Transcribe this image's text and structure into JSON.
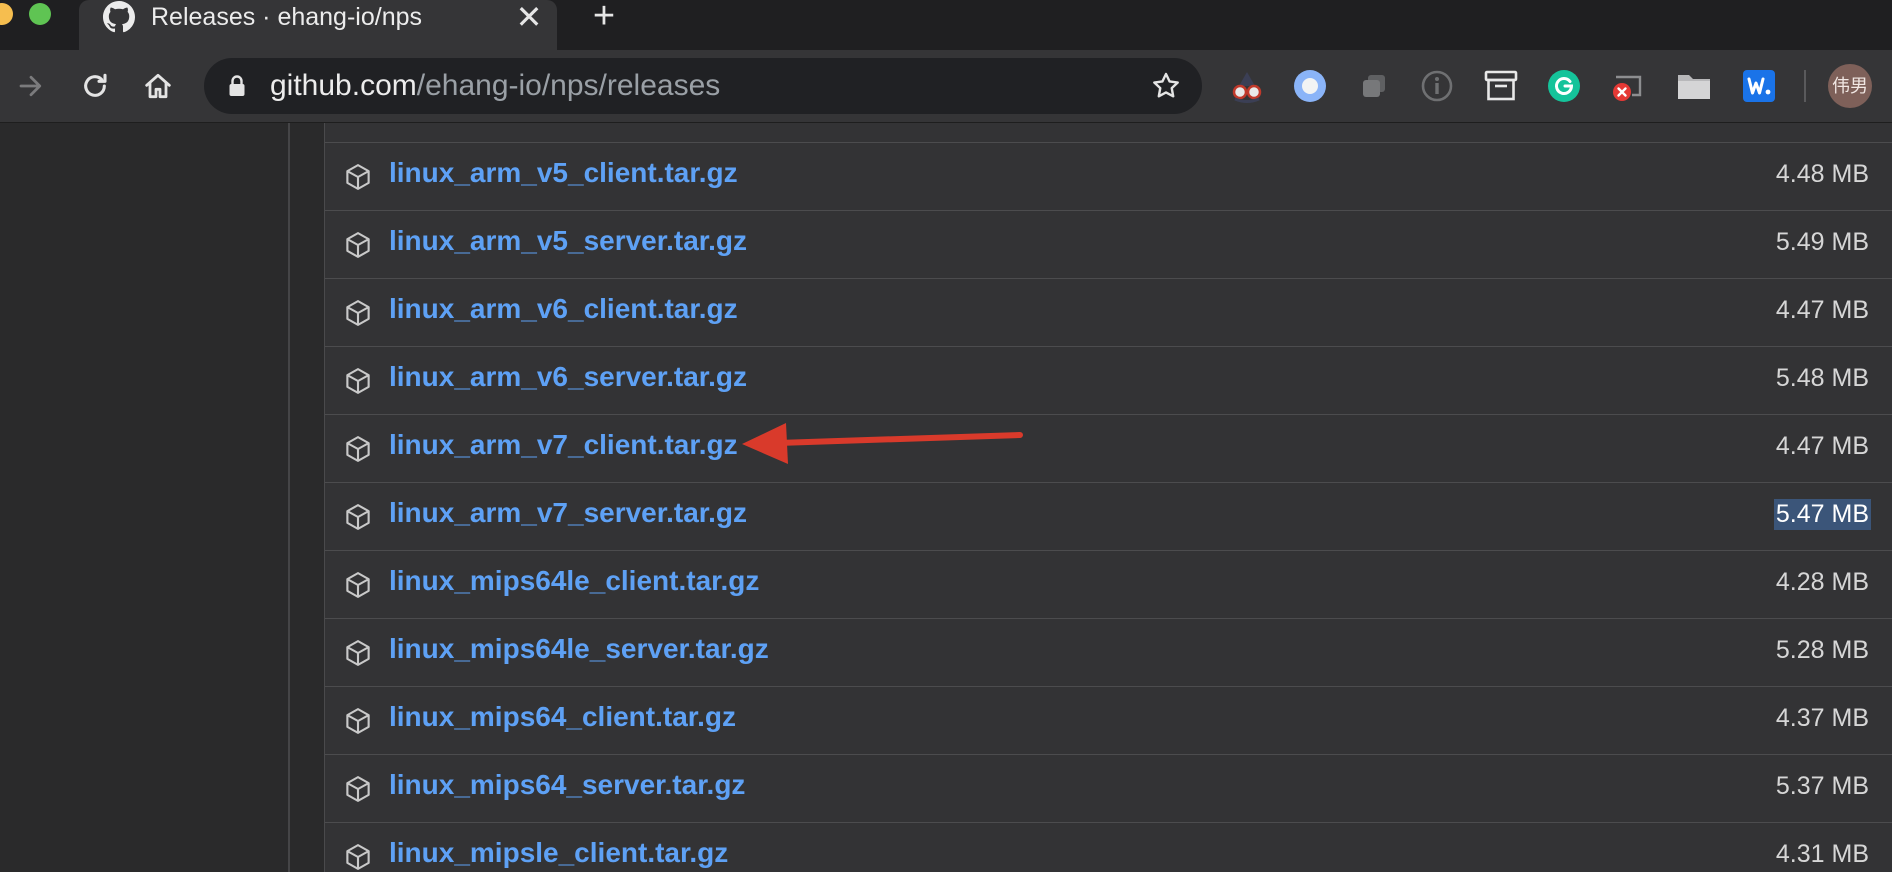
{
  "browser": {
    "tab_title": "Releases · ehang-io/nps",
    "close_glyph": "✕",
    "new_tab_glyph": "+",
    "url_host": "github.com",
    "url_path": "/ehang-io/nps/releases"
  },
  "extensions": [
    {
      "icon": "spy-glasses-icon"
    },
    {
      "icon": "circle-ring-icon",
      "color": "#8ab4f8"
    },
    {
      "icon": "copy-squares-icon"
    },
    {
      "icon": "info-circle-icon"
    },
    {
      "icon": "archive-box-icon"
    },
    {
      "icon": "grammarly-icon",
      "color": "#15c39a"
    },
    {
      "icon": "cast-blocked-icon",
      "color": "#e53935"
    },
    {
      "icon": "folder-icon"
    },
    {
      "icon": "word-w-icon",
      "color": "#1a73e8"
    }
  ],
  "profile": {
    "avatar_text": "伟男"
  },
  "assets": [
    {
      "name": "linux_arm_v5_client.tar.gz",
      "size": "4.48 MB"
    },
    {
      "name": "linux_arm_v5_server.tar.gz",
      "size": "5.49 MB"
    },
    {
      "name": "linux_arm_v6_client.tar.gz",
      "size": "4.47 MB"
    },
    {
      "name": "linux_arm_v6_server.tar.gz",
      "size": "5.48 MB"
    },
    {
      "name": "linux_arm_v7_client.tar.gz",
      "size": "4.47 MB",
      "annotated": true
    },
    {
      "name": "linux_arm_v7_server.tar.gz",
      "size": "5.47 MB",
      "selected": true
    },
    {
      "name": "linux_mips64le_client.tar.gz",
      "size": "4.28 MB"
    },
    {
      "name": "linux_mips64le_server.tar.gz",
      "size": "5.28 MB"
    },
    {
      "name": "linux_mips64_client.tar.gz",
      "size": "4.37 MB"
    },
    {
      "name": "linux_mips64_server.tar.gz",
      "size": "5.37 MB"
    },
    {
      "name": "linux_mipsle_client.tar.gz",
      "size": "4.31 MB"
    }
  ],
  "colors": {
    "link": "#5ea1f5",
    "annotation_arrow": "#d93a2b",
    "selection": "#3b5579"
  }
}
